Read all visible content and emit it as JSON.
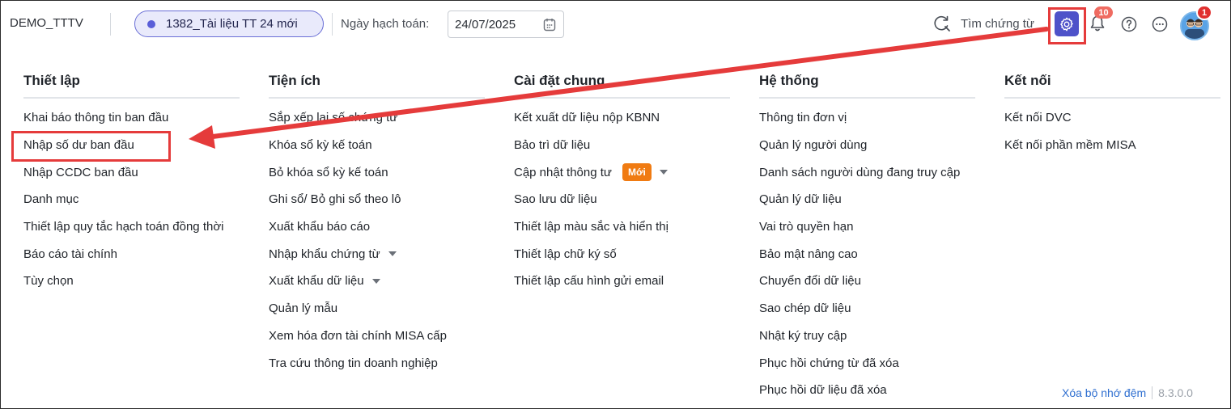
{
  "topbar": {
    "company": "DEMO_TTTV",
    "dataset": "1382_Tài liệu TT 24 mới",
    "date_label": "Ngày hạch toán:",
    "date_value": "24/07/2025",
    "search_label": "Tìm chứng từ",
    "notifications_count": "10",
    "avatar_badge": "1",
    "icons": {
      "search": "search-refresh-icon",
      "settings": "gear-icon",
      "bell": "bell-icon",
      "help": "help-icon",
      "more": "more-icon",
      "calendar": "calendar-icon"
    }
  },
  "menu": {
    "thiet_lap": {
      "heading": "Thiết lập",
      "items": [
        "Khai báo thông tin ban đầu",
        "Nhập số dư ban đầu",
        "Nhập CCDC ban đầu",
        "Danh mục",
        "Thiết lập quy tắc hạch toán đồng thời",
        "Báo cáo tài chính",
        "Tùy chọn"
      ]
    },
    "tien_ich": {
      "heading": "Tiện ích",
      "items": [
        "Sắp xếp lại số chứng từ",
        "Khóa sổ kỳ kế toán",
        "Bỏ khóa sổ kỳ kế toán",
        "Ghi sổ/ Bỏ ghi sổ theo lô",
        "Xuất khẩu báo cáo",
        "Nhập khẩu chứng từ",
        "Xuất khẩu dữ liệu",
        "Quản lý mẫu",
        "Xem hóa đơn tài chính MISA cấp",
        "Tra cứu thông tin doanh nghiệp"
      ]
    },
    "cai_dat_chung": {
      "heading": "Cài đặt chung",
      "items": [
        "Kết xuất dữ liệu nộp KBNN",
        "Bảo trì dữ liệu",
        "Cập nhật thông tư",
        "Sao lưu dữ liệu",
        "Thiết lập màu sắc và hiển thị",
        "Thiết lập chữ ký số",
        "Thiết lập cấu hình gửi email"
      ],
      "new_badge": "Mới"
    },
    "he_thong": {
      "heading": "Hệ thống",
      "items": [
        "Thông tin đơn vị",
        "Quản lý người dùng",
        "Danh sách người dùng đang truy cập",
        "Quản lý dữ liệu",
        "Vai trò quyền hạn",
        "Bảo mật nâng cao",
        "Chuyển đổi dữ liệu",
        "Sao chép dữ liệu",
        "Nhật ký truy cập",
        "Phục hồi chứng từ đã xóa",
        "Phục hồi dữ liệu đã xóa"
      ]
    },
    "ket_noi": {
      "heading": "Kết nối",
      "items": [
        "Kết nối DVC",
        "Kết nối phần mềm MISA"
      ]
    }
  },
  "footer": {
    "clear_cache": "Xóa bộ nhớ đệm",
    "version": "8.3.0.0"
  },
  "colors": {
    "accent": "#4e52c9",
    "annotation_red": "#e53b3b",
    "new_badge": "#f07b12",
    "link": "#2f6fd0"
  }
}
